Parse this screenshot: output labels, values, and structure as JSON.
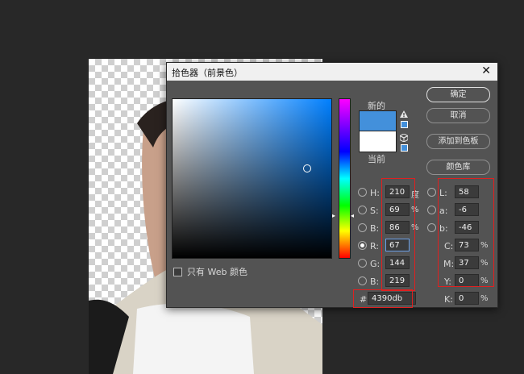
{
  "dialog": {
    "title": "拾色器（前景色）",
    "close_glyph": "✕"
  },
  "colors": {
    "selected": "#4390db",
    "current": "#ffffff",
    "annotation": "#e02020"
  },
  "labels": {
    "new": "新的",
    "current": "当前"
  },
  "buttons": {
    "ok": "确定",
    "cancel": "取消",
    "add_to_swatches": "添加到色板",
    "color_libraries": "颜色库"
  },
  "web_only": {
    "label": "只有 Web 颜色",
    "checked": false
  },
  "icons": {
    "gamut_warning": "warning-triangle-icon",
    "web_safe": "cube-icon",
    "hue_arrow_left": "▸",
    "hue_arrow_right": "◂"
  },
  "hsb": {
    "h": {
      "label": "H:",
      "value": "210",
      "unit": "度"
    },
    "s": {
      "label": "S:",
      "value": "69",
      "unit": "%"
    },
    "b": {
      "label": "B:",
      "value": "86",
      "unit": "%"
    }
  },
  "rgb": {
    "r": {
      "label": "R:",
      "value": "67",
      "selected": true
    },
    "g": {
      "label": "G:",
      "value": "144"
    },
    "b": {
      "label": "B:",
      "value": "219"
    }
  },
  "lab": {
    "l": {
      "label": "L:",
      "value": "58"
    },
    "a": {
      "label": "a:",
      "value": "-6"
    },
    "b": {
      "label": "b:",
      "value": "-46"
    }
  },
  "cmyk": {
    "c": {
      "label": "C:",
      "value": "73",
      "unit": "%"
    },
    "m": {
      "label": "M:",
      "value": "37",
      "unit": "%"
    },
    "y": {
      "label": "Y:",
      "value": "0",
      "unit": "%"
    },
    "k": {
      "label": "K:",
      "value": "0",
      "unit": "%"
    }
  },
  "hex": {
    "label": "#",
    "value": "4390db"
  }
}
